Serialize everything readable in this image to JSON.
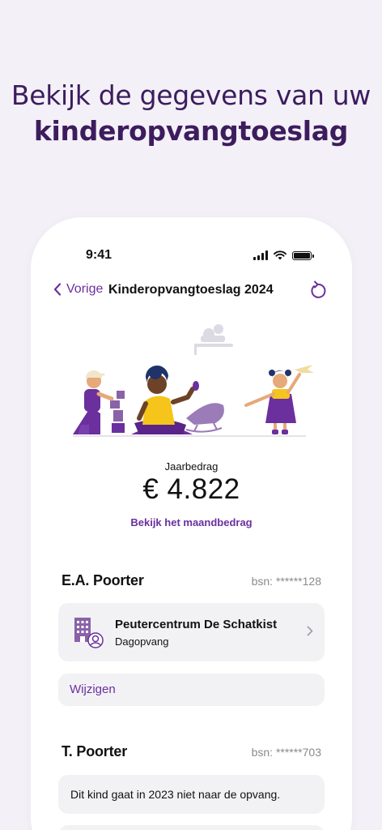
{
  "headline": {
    "line1": "Bekijk de gegevens van uw",
    "line2": "kinderopvangtoeslag"
  },
  "statusbar": {
    "time": "9:41"
  },
  "navbar": {
    "back_label": "Vorige",
    "title": "Kinderopvangtoeslag 2024"
  },
  "summary": {
    "label": "Jaarbedrag",
    "amount": "€ 4.822",
    "monthly_link": "Bekijk het maandbedrag"
  },
  "children": [
    {
      "name": "E.A. Poorter",
      "bsn": "bsn: ******128",
      "provider": {
        "name": "Peutercentrum De Schatkist",
        "type": "Dagopvang"
      },
      "change_label": "Wijzigen"
    },
    {
      "name": "T. Poorter",
      "bsn": "bsn: ******703",
      "note": "Dit kind gaat in 2023 niet naar de opvang."
    }
  ],
  "colors": {
    "accent": "#6b2f9e",
    "headline": "#3d1c5e",
    "background": "#f3f1f7",
    "card": "#f2f2f5"
  }
}
